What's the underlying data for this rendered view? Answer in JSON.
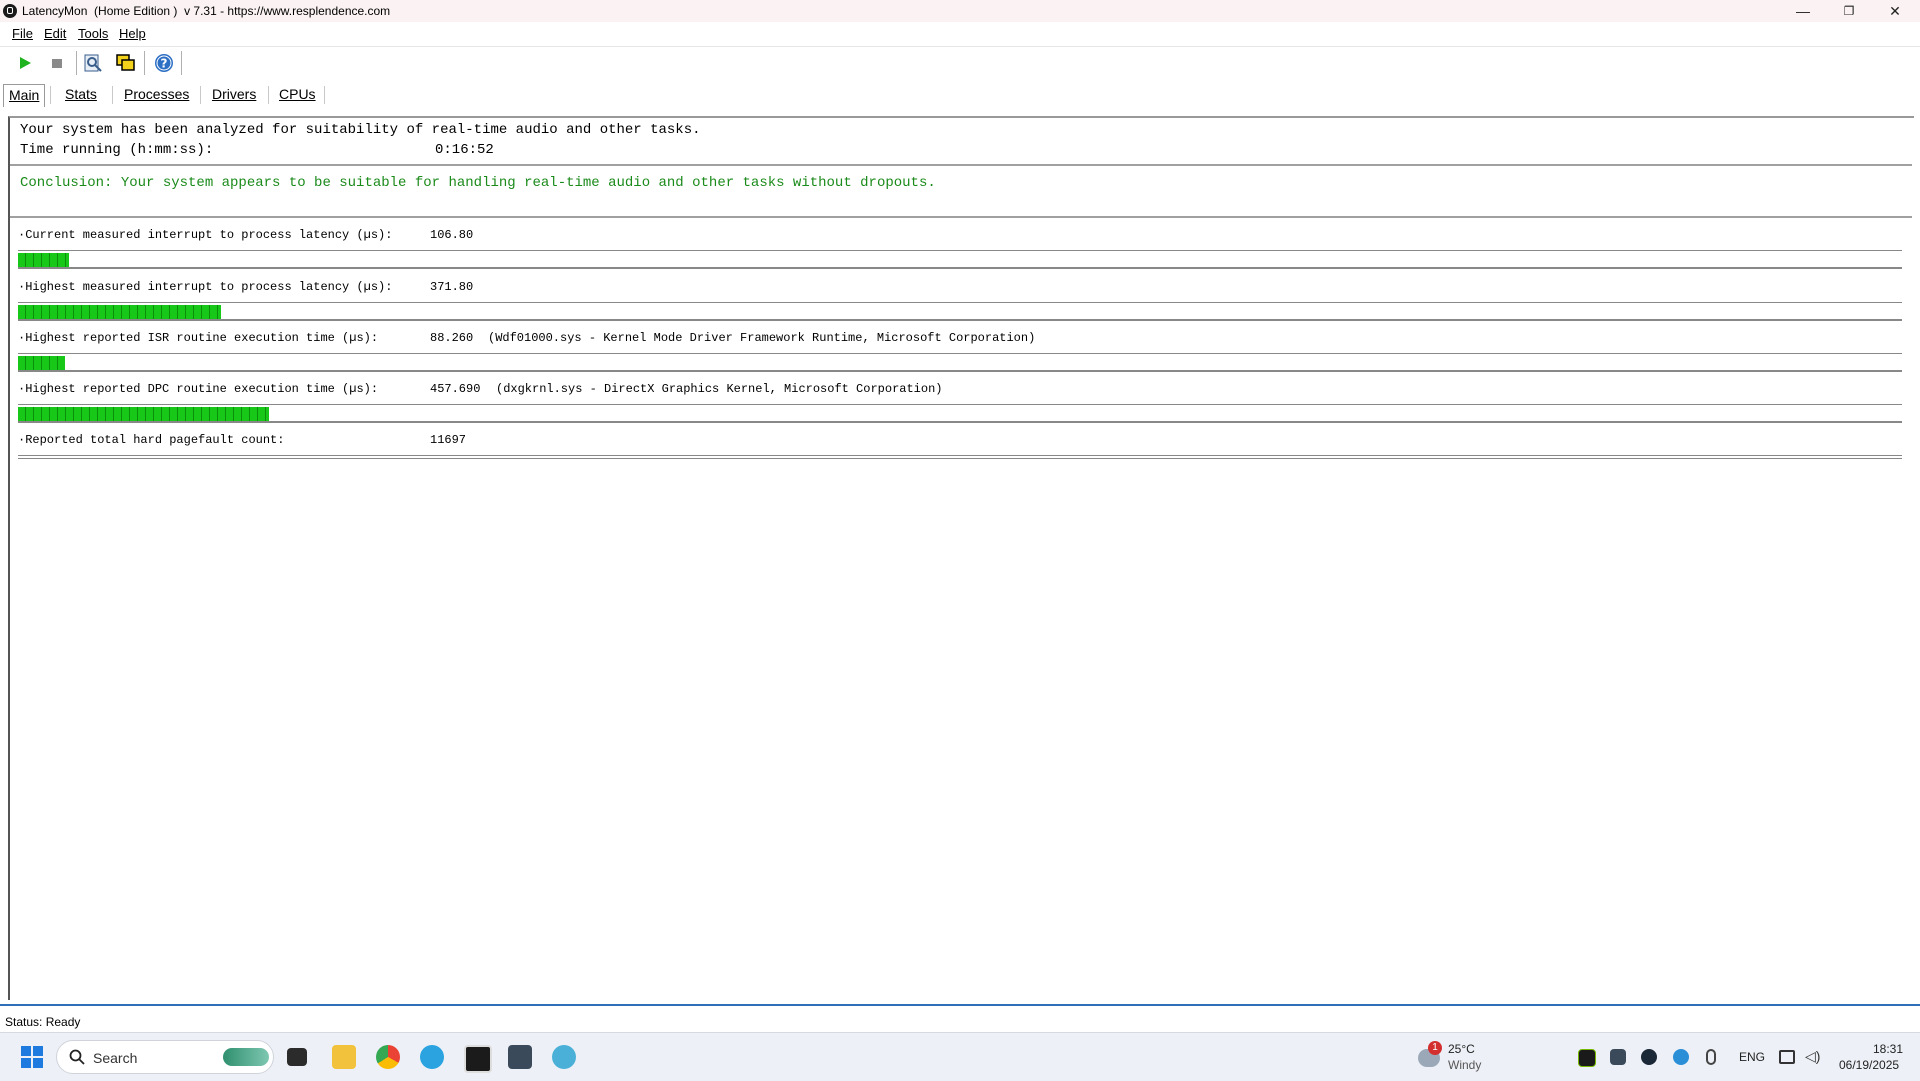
{
  "window": {
    "title": "LatencyMon  (Home Edition )  v 7.31 - https://www.resplendence.com",
    "minimize": "—",
    "maximize": "❐",
    "close": "✕"
  },
  "menu": [
    {
      "label": "File"
    },
    {
      "label": "Edit"
    },
    {
      "label": "Tools"
    },
    {
      "label": "Help"
    }
  ],
  "toolbar": {
    "start": "play-icon",
    "stop": "stop-icon",
    "report": "report-icon",
    "windows": "windows-icon",
    "help": "?"
  },
  "tabs": [
    {
      "label": "Main",
      "active": true
    },
    {
      "label": "Stats"
    },
    {
      "label": "Processes"
    },
    {
      "label": "Drivers"
    },
    {
      "label": "CPUs"
    }
  ],
  "summary": {
    "analyzed": "Your system has been analyzed for suitability of real-time audio and other tasks.",
    "time_label": "Time running (h:mm:ss):",
    "time_value": "0:16:52",
    "conclusion": "Conclusion: Your system appears to be suitable for handling real-time audio and other tasks without dropouts.",
    "conclusion_color": "#1a8a1a"
  },
  "metrics": [
    {
      "label": "·Current measured interrupt to process latency (µs):",
      "value": "106.80",
      "detail": "",
      "bar_fraction": 0.027
    },
    {
      "label": "·Highest measured interrupt to process latency (µs):",
      "value": "371.80",
      "detail": "",
      "bar_fraction": 0.108
    },
    {
      "label": "·Highest reported ISR routine execution time (µs):",
      "value": "88.260",
      "detail": "(Wdf01000.sys - Kernel Mode Driver Framework Runtime, Microsoft Corporation)",
      "bar_fraction": 0.025
    },
    {
      "label": "·Highest reported DPC routine execution time (µs):",
      "value": "457.690",
      "detail": "(dxgkrnl.sys - DirectX Graphics Kernel, Microsoft Corporation)",
      "bar_fraction": 0.133
    },
    {
      "label": "·Reported total hard pagefault count:",
      "value": "11697",
      "detail": ""
    }
  ],
  "status": "Status: Ready",
  "taskbar": {
    "search_placeholder": "Search",
    "weather_temp": "25°C",
    "weather_desc": "Windy",
    "weather_badge": "1",
    "lang": "ENG",
    "time": "18:31",
    "date": "06/19/2025"
  }
}
